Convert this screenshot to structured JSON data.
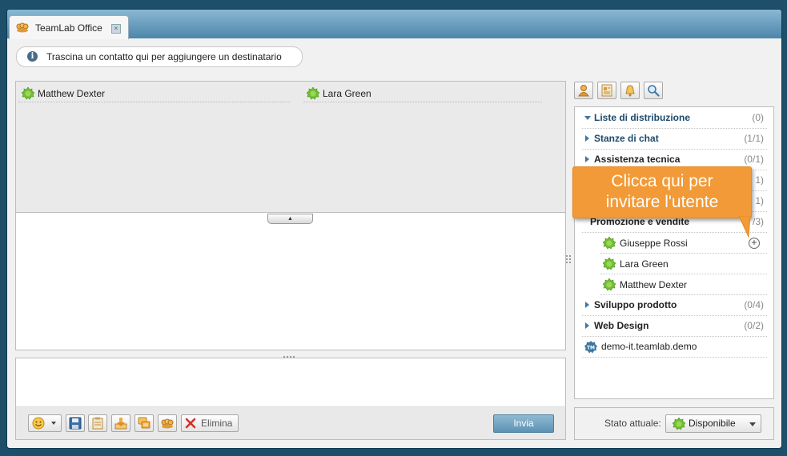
{
  "window": {
    "tab_title": "TeamLab Office",
    "tab_icon": "teamlab-logo-icon",
    "close_icon": "tab-close-icon"
  },
  "info": {
    "icon": "info-icon",
    "text": "Trascina un contatto qui per aggiungere un destinatario"
  },
  "recipients": [
    {
      "name": "Matthew Dexter",
      "status": "online"
    },
    {
      "name": "Lara Green",
      "status": "online"
    }
  ],
  "toolbar": {
    "buttons": [
      "smiley-icon",
      "save-icon",
      "clipboard-icon",
      "import-icon",
      "history-icon",
      "teamlab-icon"
    ],
    "delete_label": "Elimina",
    "send_label": "Invia"
  },
  "side_tools": [
    "user-icon",
    "notes-icon",
    "alert-icon",
    "search-icon"
  ],
  "contacts": {
    "groups_top": [
      {
        "name": "Liste di distribuzione",
        "count": "(0)",
        "expanded": true
      },
      {
        "name": "Stanze di chat",
        "count": "(1/1)",
        "expanded": false
      },
      {
        "name": "Assistenza tecnica",
        "count": "(0/1)",
        "expanded": false
      }
    ],
    "hidden_counts": [
      "1)",
      "1)",
      "/3)"
    ],
    "expanded_group_fragment": "Promozione e vendite",
    "members": [
      {
        "name": "Giuseppe Rossi",
        "status": "online"
      },
      {
        "name": "Lara Green",
        "status": "online"
      },
      {
        "name": "Matthew Dexter",
        "status": "online"
      }
    ],
    "groups_bottom": [
      {
        "name": "Sviluppo prodotto",
        "count": "(0/4)"
      },
      {
        "name": "Web Design",
        "count": "(0/2)"
      }
    ],
    "server": "demo-it.teamlab.demo"
  },
  "callout": {
    "line1": "Clicca qui per",
    "line2": "invitare l'utente",
    "color": "#f19a37"
  },
  "status": {
    "label": "Stato attuale:",
    "value": "Disponibile",
    "color": "#6fbf2f"
  }
}
